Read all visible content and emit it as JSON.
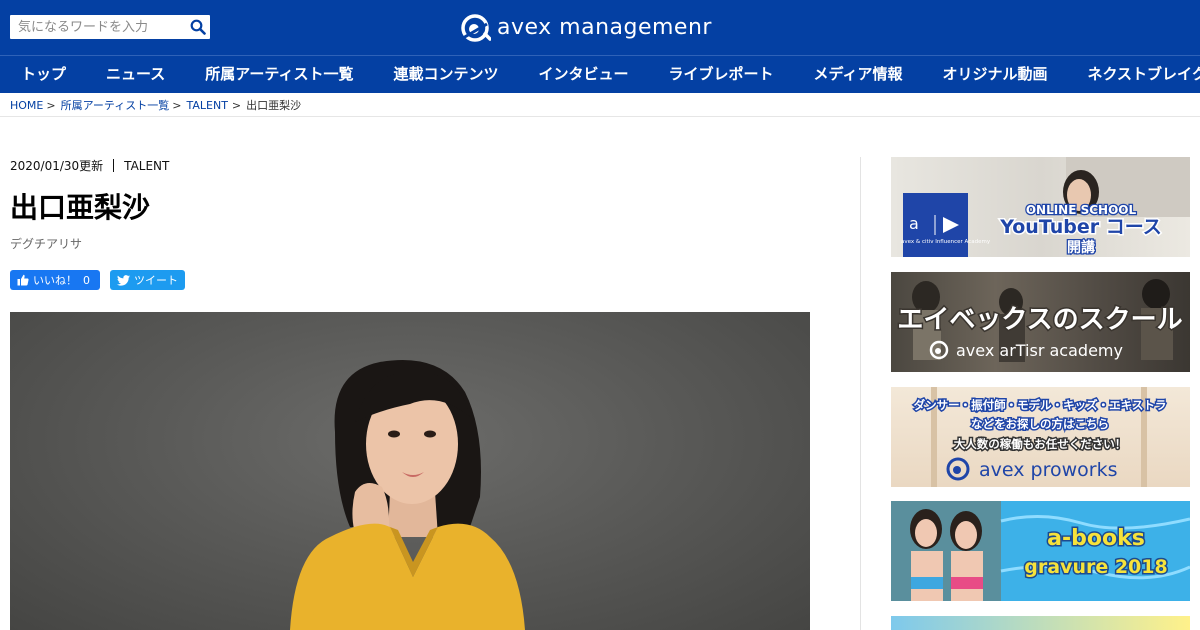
{
  "header": {
    "search_placeholder": "気になるワードを入力",
    "logo_text": "avex managemenr"
  },
  "nav": {
    "items": [
      "トップ",
      "ニュース",
      "所属アーティスト一覧",
      "連載コンテンツ",
      "インタビュー",
      "ライブレポート",
      "メディア情報",
      "オリジナル動画",
      "ネクストブレイク"
    ]
  },
  "breadcrumb": {
    "home": "HOME",
    "list": "所属アーティスト一覧",
    "category": "TALENT",
    "current": "出口亜梨沙",
    "separator": ">"
  },
  "article": {
    "updated": "2020/01/30更新",
    "category": "TALENT",
    "name": "出口亜梨沙",
    "kana": "デグチアリサ",
    "like_label": "いいね！",
    "like_count": "0",
    "tweet_label": "ツイート"
  },
  "sidebar": {
    "banner1": {
      "line1": "ONLINE SCHOOL",
      "line2": "YouTuber コース",
      "line3": "開講",
      "small": "avex & citiv Influencer Academy"
    },
    "banner2": {
      "line1": "エイベックスのスクール",
      "line2": "avex arTisr academy"
    },
    "banner3": {
      "line1": "ダンサー・振付師・モデル・キッズ・エキストラ",
      "line2": "などをお探しの方はこちら",
      "line3": "大人数の稼働もお任せください！",
      "line4": "avex proworks"
    },
    "banner4": {
      "line1": "a-books",
      "line2": "gravure 2018"
    }
  },
  "colors": {
    "header_blue": "#0440a3",
    "facebook_blue": "#1877f2",
    "twitter_blue": "#1d9bf0"
  }
}
